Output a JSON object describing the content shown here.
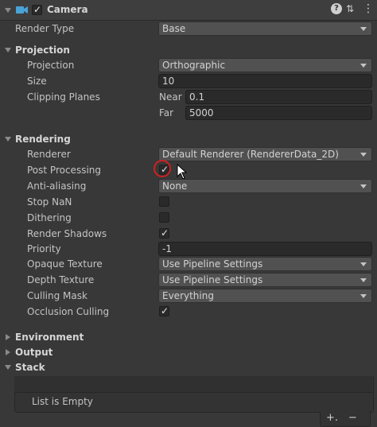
{
  "header": {
    "title": "Camera",
    "enabled": true,
    "icons": [
      "camera-icon",
      "help-icon",
      "presets-icon",
      "more-icon"
    ]
  },
  "render_type": {
    "label": "Render Type",
    "value": "Base"
  },
  "projection_section": {
    "title": "Projection",
    "projection": {
      "label": "Projection",
      "value": "Orthographic"
    },
    "size": {
      "label": "Size",
      "value": "10"
    },
    "clipping": {
      "label": "Clipping Planes",
      "near_label": "Near",
      "near": "0.1",
      "far_label": "Far",
      "far": "5000"
    }
  },
  "rendering_section": {
    "title": "Rendering",
    "renderer": {
      "label": "Renderer",
      "value": "Default Renderer (RendererData_2D)"
    },
    "post_processing": {
      "label": "Post Processing",
      "checked": true
    },
    "anti_aliasing": {
      "label": "Anti-aliasing",
      "value": "None"
    },
    "stop_nan": {
      "label": "Stop NaN",
      "checked": false
    },
    "dithering": {
      "label": "Dithering",
      "checked": false
    },
    "render_shadows": {
      "label": "Render Shadows",
      "checked": true
    },
    "priority": {
      "label": "Priority",
      "value": "-1"
    },
    "opaque_texture": {
      "label": "Opaque Texture",
      "value": "Use Pipeline Settings"
    },
    "depth_texture": {
      "label": "Depth Texture",
      "value": "Use Pipeline Settings"
    },
    "culling_mask": {
      "label": "Culling Mask",
      "value": "Everything"
    },
    "occlusion_culling": {
      "label": "Occlusion Culling",
      "checked": true
    }
  },
  "collapsed_sections": {
    "environment": "Environment",
    "output": "Output"
  },
  "stack_section": {
    "title": "Stack",
    "empty_text": "List is Empty",
    "add_label": "+.",
    "remove_label": "−"
  },
  "colors": {
    "background": "#383838",
    "field": "#2a2a2a",
    "dropdown": "#515151",
    "highlight_circle": "#d02020",
    "camera_icon": "#49a3d8"
  }
}
